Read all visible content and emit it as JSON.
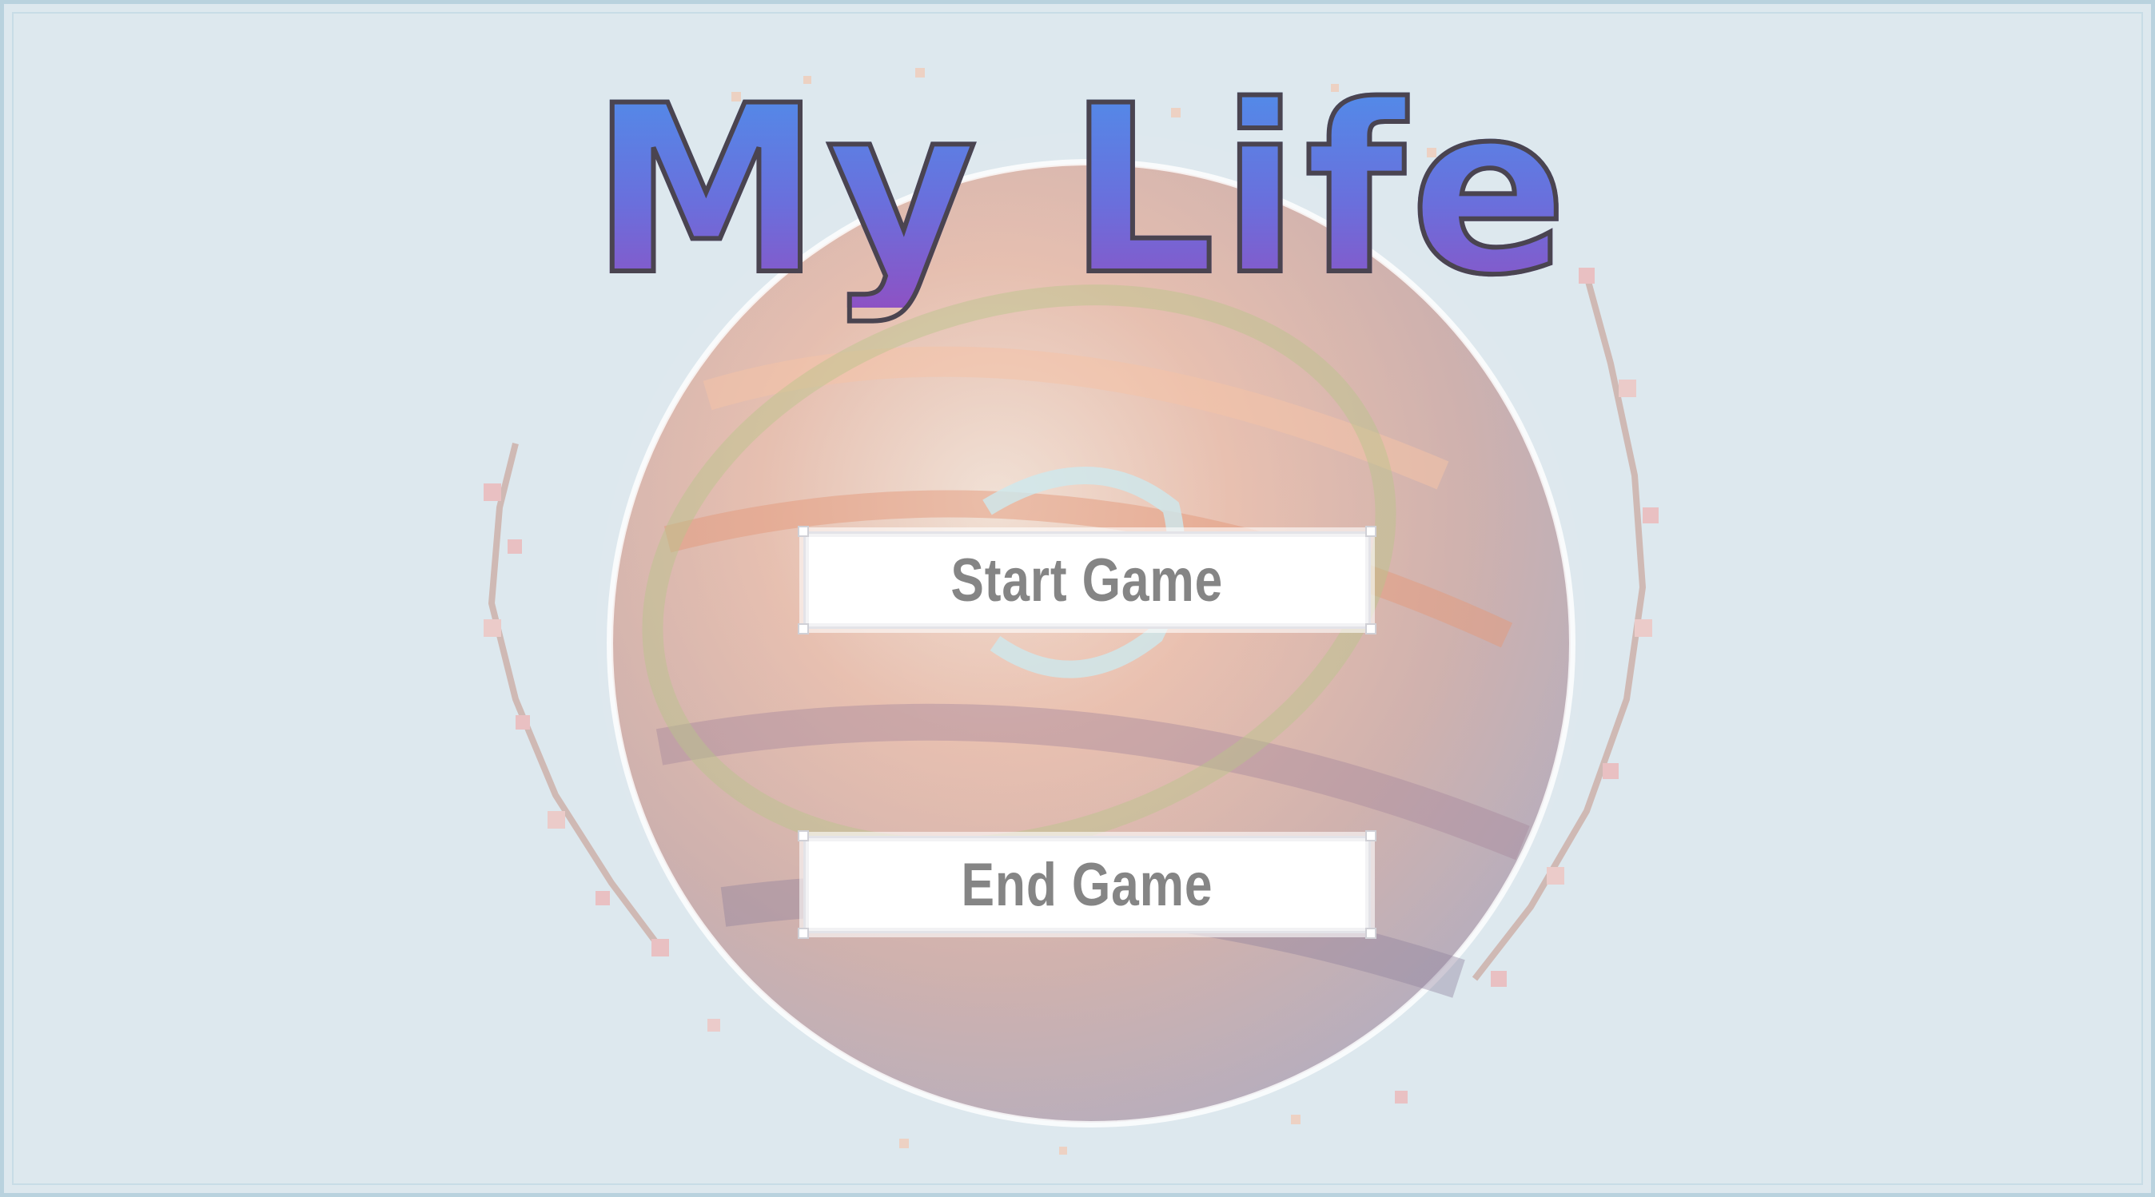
{
  "title": "My Life",
  "menu": {
    "start_label": "Start Game",
    "end_label": "End Game"
  },
  "colors": {
    "background": "#dde8ee",
    "title_gradient_top": "#4f8eea",
    "title_gradient_bottom": "#8d52c4",
    "title_outline": "#4a4450",
    "button_fill": "#ffffff",
    "button_text": "#858585"
  },
  "background_art": "pixel-planet-with-blossom-branches"
}
